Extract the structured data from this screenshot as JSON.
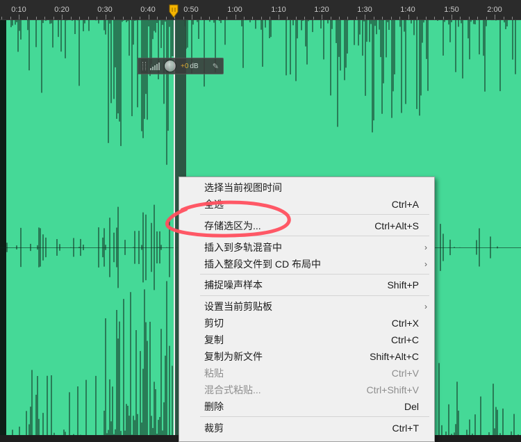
{
  "ruler": {
    "ticks": [
      "0:10",
      "0:20",
      "0:30",
      "0:40",
      "0:50",
      "1:00",
      "1:10",
      "1:20",
      "1:30",
      "1:40",
      "1:50",
      "2:00"
    ]
  },
  "hud": {
    "value": "+0",
    "unit": "dB"
  },
  "context_menu": {
    "items": [
      {
        "label": "选择当前视图时间",
        "shortcut": "",
        "enabled": true,
        "submenu": false
      },
      {
        "label": "全选",
        "shortcut": "Ctrl+A",
        "enabled": true,
        "submenu": false
      },
      {
        "label": "存储选区为...",
        "shortcut": "Ctrl+Alt+S",
        "enabled": true,
        "submenu": false
      },
      {
        "label": "插入到多轨混音中",
        "shortcut": "",
        "enabled": true,
        "submenu": true
      },
      {
        "label": "插入整段文件到 CD 布局中",
        "shortcut": "",
        "enabled": true,
        "submenu": true
      },
      {
        "label": "捕捉噪声样本",
        "shortcut": "Shift+P",
        "enabled": true,
        "submenu": false
      },
      {
        "label": "设置当前剪贴板",
        "shortcut": "",
        "enabled": true,
        "submenu": true
      },
      {
        "label": "剪切",
        "shortcut": "Ctrl+X",
        "enabled": true,
        "submenu": false
      },
      {
        "label": "复制",
        "shortcut": "Ctrl+C",
        "enabled": true,
        "submenu": false
      },
      {
        "label": "复制为新文件",
        "shortcut": "Shift+Alt+C",
        "enabled": true,
        "submenu": false
      },
      {
        "label": "粘贴",
        "shortcut": "Ctrl+V",
        "enabled": false,
        "submenu": false
      },
      {
        "label": "混合式粘贴...",
        "shortcut": "Ctrl+Shift+V",
        "enabled": false,
        "submenu": false
      },
      {
        "label": "删除",
        "shortcut": "Del",
        "enabled": true,
        "submenu": false
      },
      {
        "label": "裁剪",
        "shortcut": "Ctrl+T",
        "enabled": true,
        "submenu": false
      }
    ]
  },
  "colors": {
    "waveform": "#45d997",
    "annotation": "#ff4f5e",
    "playhead_marker": "#f5b400"
  }
}
